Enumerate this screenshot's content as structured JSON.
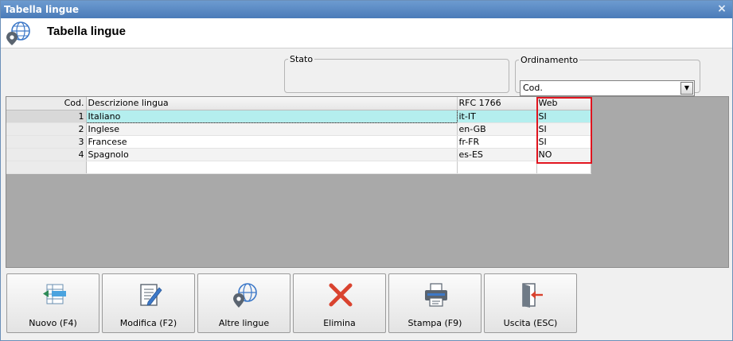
{
  "window": {
    "title": "Tabella lingue",
    "close_glyph": "×"
  },
  "header": {
    "title": "Tabella lingue",
    "logo_icon": "globe-pin-icon"
  },
  "stato": {
    "legend": "Stato"
  },
  "ordinamento": {
    "legend": "Ordinamento",
    "selected": "Cod.",
    "arrow_glyph": "▼"
  },
  "grid": {
    "columns": [
      "Cod.",
      "Descrizione lingua",
      "RFC 1766",
      "Web"
    ],
    "rows": [
      {
        "cod": "1",
        "descrizione": "Italiano",
        "rfc": "it-IT",
        "web": "SI"
      },
      {
        "cod": "2",
        "descrizione": "Inglese",
        "rfc": "en-GB",
        "web": "SI"
      },
      {
        "cod": "3",
        "descrizione": "Francese",
        "rfc": "fr-FR",
        "web": "SI"
      },
      {
        "cod": "4",
        "descrizione": "Spagnolo",
        "rfc": "es-ES",
        "web": "NO"
      }
    ],
    "selected_row_color": "#b4eeee",
    "highlight_color": "#e0141e"
  },
  "buttons": {
    "nuovo": {
      "label": "Nuovo (F4)",
      "icon": "add-row-icon"
    },
    "modifica": {
      "label": "Modifica (F2)",
      "icon": "edit-document-icon"
    },
    "altre_lingue": {
      "label": "Altre lingue",
      "icon": "globe-pin-icon"
    },
    "elimina": {
      "label": "Elimina",
      "icon": "delete-x-icon"
    },
    "stampa": {
      "label": "Stampa (F9)",
      "icon": "printer-icon"
    },
    "uscita": {
      "label": "Uscita (ESC)",
      "icon": "exit-door-icon"
    }
  }
}
